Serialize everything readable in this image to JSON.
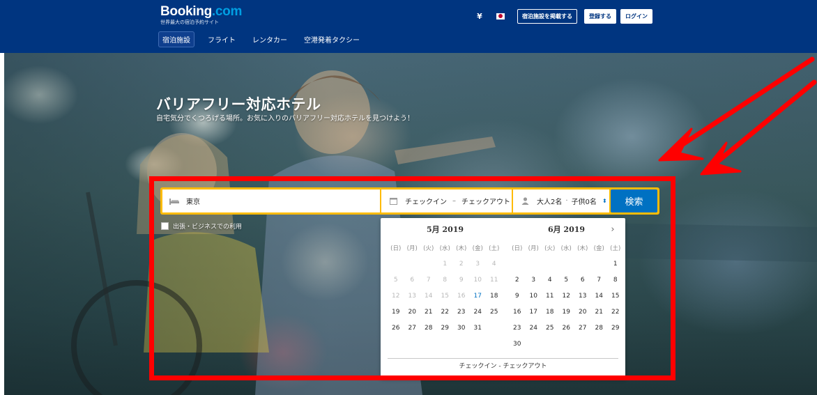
{
  "header": {
    "logo_main": "Booking",
    "logo_suffix": ".com",
    "logo_tagline": "世界最大の宿泊予約サイト",
    "currency": "¥",
    "list_property_label": "宿泊施設を掲載する",
    "register_label": "登録する",
    "login_label": "ログイン"
  },
  "nav": {
    "tabs": [
      {
        "label": "宿泊施設",
        "active": true
      },
      {
        "label": "フライト"
      },
      {
        "label": "レンタカー"
      },
      {
        "label": "空港発着タクシー"
      }
    ]
  },
  "hero": {
    "title": "バリアフリー対応ホテル",
    "subtitle": "自宅気分でくつろげる場所。お気に入りのバリアフリー対応ホテルを見つけよう！"
  },
  "search": {
    "destination": "東京",
    "checkin": "チェックイン",
    "date_separator": "–",
    "checkout": "チェックアウト",
    "adults": "大人2名",
    "guest_separator": "·",
    "children": "子供0名",
    "search_label": "検索",
    "business_label": "出張・ビジネスでの利用"
  },
  "calendar": {
    "weekdays": [
      "(日)",
      "(月)",
      "(火)",
      "(水)",
      "(木)",
      "(金)",
      "(土)"
    ],
    "months": [
      {
        "title": "5月 2019",
        "weeks": [
          [
            "",
            "",
            "",
            "1",
            "2",
            "3",
            "4"
          ],
          [
            "5",
            "6",
            "7",
            "8",
            "9",
            "10",
            "11"
          ],
          [
            "12",
            "13",
            "14",
            "15",
            "16",
            "17",
            "18"
          ],
          [
            "19",
            "20",
            "21",
            "22",
            "23",
            "24",
            "25"
          ],
          [
            "26",
            "27",
            "28",
            "29",
            "30",
            "31",
            ""
          ]
        ]
      },
      {
        "title": "6月 2019",
        "weeks": [
          [
            "",
            "",
            "",
            "",
            "",
            "",
            "1"
          ],
          [
            "2",
            "3",
            "4",
            "5",
            "6",
            "7",
            "8"
          ],
          [
            "9",
            "10",
            "11",
            "12",
            "13",
            "14",
            "15"
          ],
          [
            "16",
            "17",
            "18",
            "19",
            "20",
            "21",
            "22"
          ],
          [
            "23",
            "24",
            "25",
            "26",
            "27",
            "28",
            "29"
          ],
          [
            "30",
            "",
            "",
            "",
            "",
            "",
            ""
          ]
        ]
      }
    ],
    "past_days_may": [
      "1",
      "2",
      "3",
      "4",
      "5",
      "6",
      "7",
      "8",
      "9",
      "10",
      "11",
      "12",
      "13",
      "14",
      "15",
      "16"
    ],
    "today_may": "17",
    "footer": "チェックイン - チェックアウト"
  },
  "colors": {
    "brand_blue": "#003580",
    "search_yellow": "#febb02",
    "button_blue": "#0071c2",
    "annotation_red": "#ff0000"
  }
}
